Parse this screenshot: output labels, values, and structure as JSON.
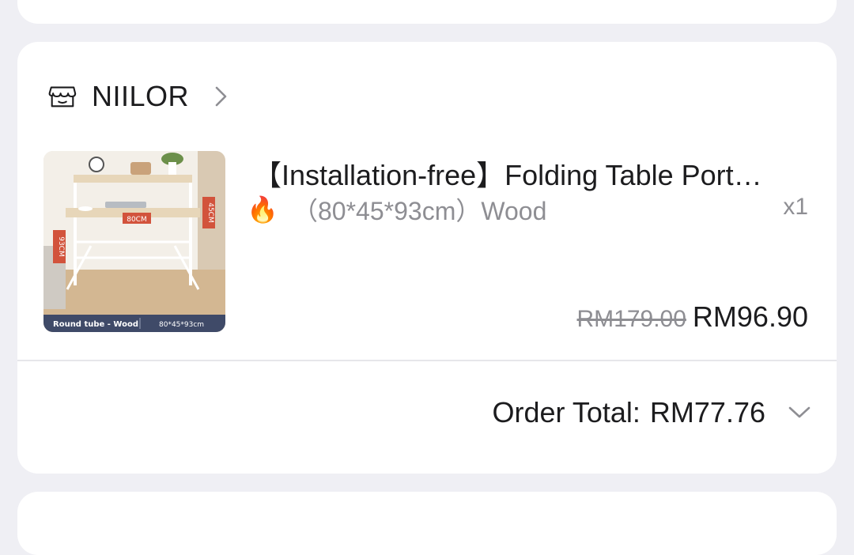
{
  "order": {
    "shop": {
      "name": "NIILOR",
      "icon": "store-icon"
    },
    "item": {
      "title": "【Installation-free】Folding Table Port…",
      "variant": "（80*45*93cm）Wood",
      "variant_icon": "fire-icon",
      "variant_emoji": "🔥",
      "quantity": "x1",
      "original_price": "RM179.00",
      "price": "RM96.90",
      "thumbnail": {
        "label_top_width": "80CM",
        "label_depth": "45CM",
        "label_height": "93CM",
        "caption_left": "Round tube - Wood",
        "caption_right": "80*45*93cm"
      }
    },
    "total": {
      "label": "Order Total:",
      "value": "RM77.76"
    }
  },
  "colors": {
    "background": "#efeff4",
    "card": "#ffffff",
    "text": "#1c1c1e",
    "muted": "#8e8e93",
    "divider": "#e6e6ea"
  }
}
